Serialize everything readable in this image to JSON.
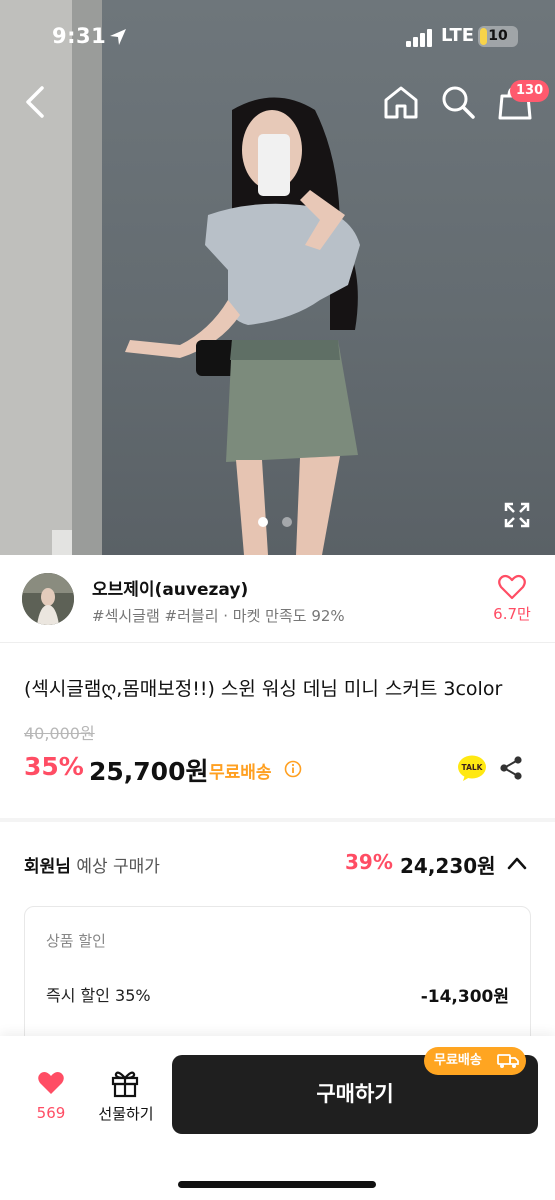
{
  "status_bar": {
    "time": "9:31",
    "network": "LTE",
    "battery_level": "10"
  },
  "header": {
    "cart_count": "130"
  },
  "gallery": {
    "current_index": 1,
    "total": 2
  },
  "seller": {
    "name": "오브제이(auvezay)",
    "tags": "#섹시글램 #러블리 · 마켓 만족도 92%",
    "likes": "6.7만"
  },
  "product": {
    "title": "(섹시글램ღ,몸매보정!!) 스윈 워싱 데님 미니 스커트 3color",
    "original_price": "40,000원",
    "discount_rate": "35%",
    "sale_price": "25,700원",
    "free_shipping": "무료배송"
  },
  "member_price": {
    "label_strong": "회원님",
    "label_rest": " 예상 구매가",
    "discount_rate": "39%",
    "price": "24,230원",
    "breakdown": {
      "heading": "상품 할인",
      "item_label": "즉시 할인 35%",
      "item_value": "-14,300원"
    }
  },
  "bottom_bar": {
    "wish_count": "569",
    "gift_label": "선물하기",
    "buy_label": "구매하기",
    "shipping_badge": "무료배송"
  },
  "colors": {
    "accent_red": "#ff4d64",
    "shipping_orange": "#ffa021",
    "buy_button": "#1f1f1f"
  }
}
